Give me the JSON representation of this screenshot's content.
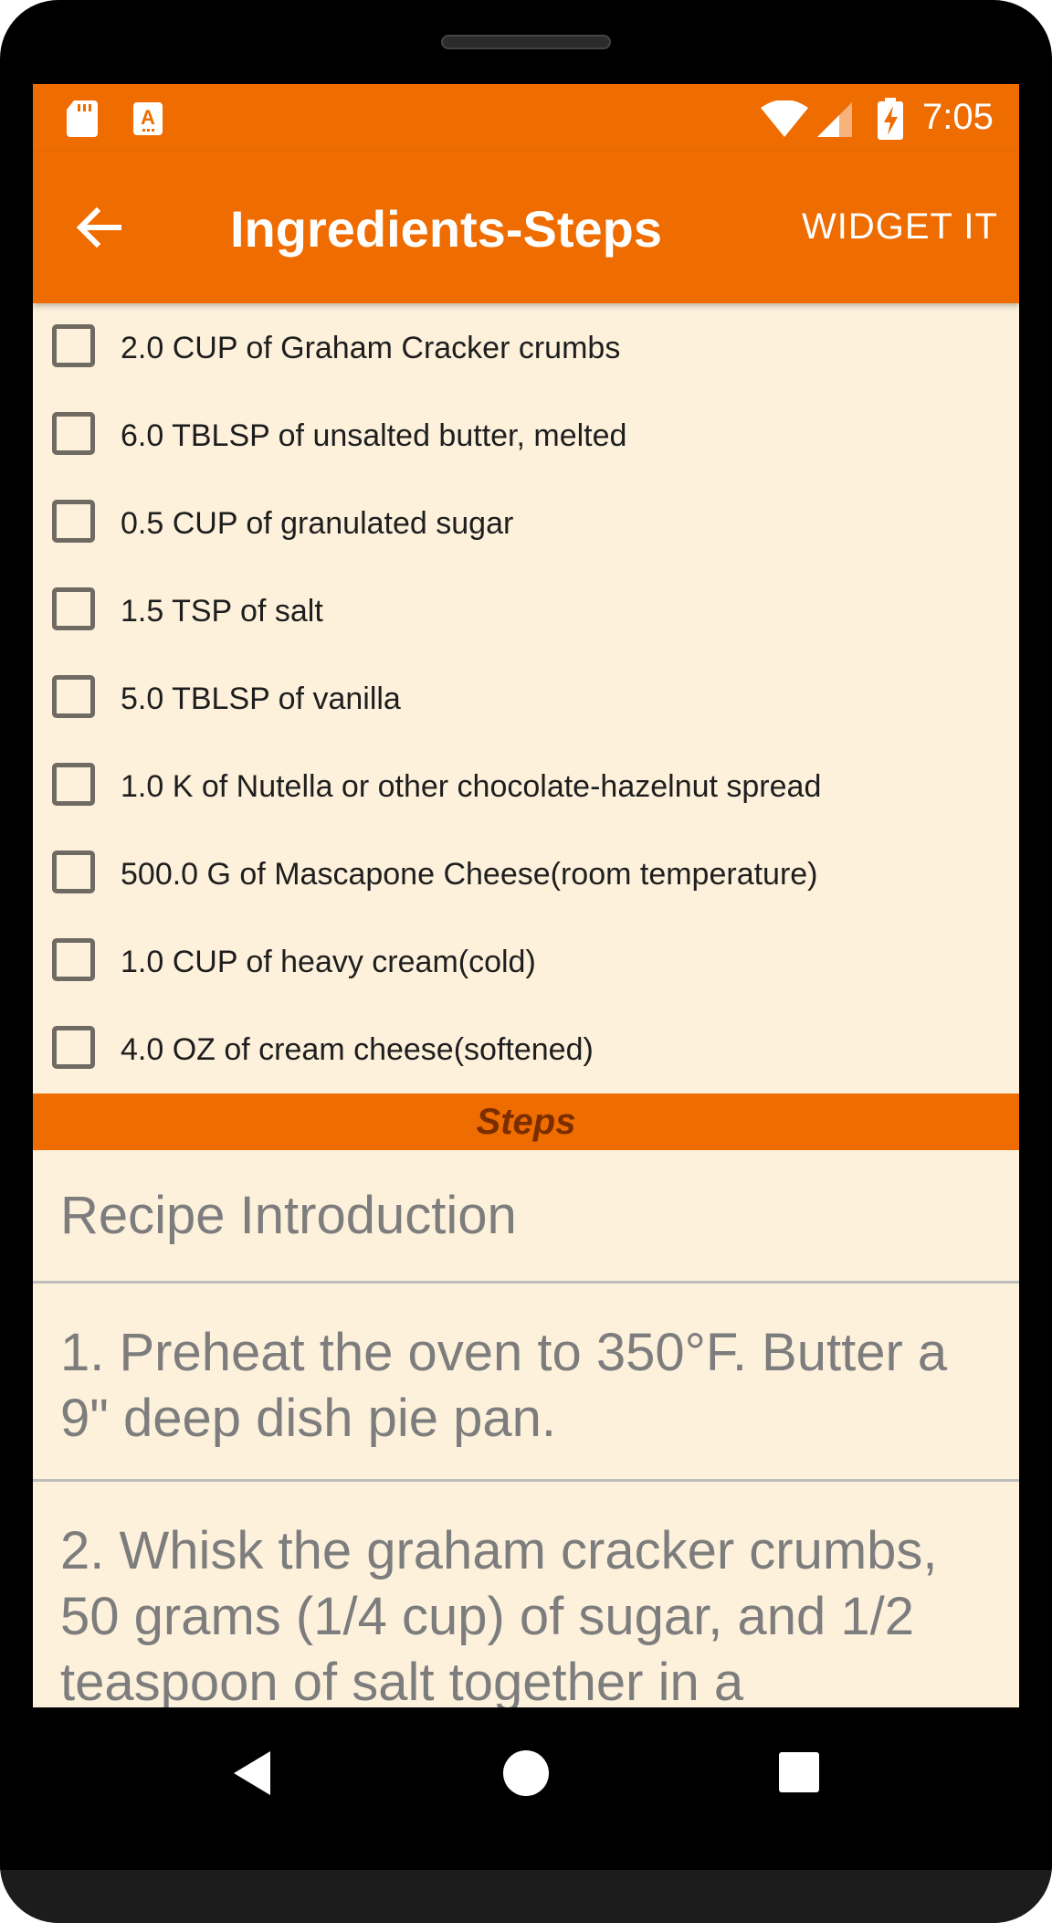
{
  "status_bar": {
    "time": "7:05",
    "icons": [
      "sd-card-icon",
      "accessibility-a-icon",
      "wifi-icon",
      "cell-signal-icon",
      "battery-charging-icon"
    ]
  },
  "app_bar": {
    "title": "Ingredients-Steps",
    "back_icon": "arrow-left-icon",
    "action_label": "WIDGET IT",
    "color": "#ef6c00"
  },
  "ingredients": [
    {
      "label": "2.0 CUP of Graham Cracker crumbs",
      "checked": false
    },
    {
      "label": "6.0 TBLSP of unsalted butter, melted",
      "checked": false
    },
    {
      "label": "0.5 CUP of granulated sugar",
      "checked": false
    },
    {
      "label": "1.5 TSP of salt",
      "checked": false
    },
    {
      "label": "5.0 TBLSP of vanilla",
      "checked": false
    },
    {
      "label": "1.0 K of Nutella or other chocolate-hazelnut spread",
      "checked": false
    },
    {
      "label": "500.0 G of Mascapone Cheese(room temperature)",
      "checked": false
    },
    {
      "label": "1.0 CUP of heavy cream(cold)",
      "checked": false
    },
    {
      "label": "4.0 OZ of cream cheese(softened)",
      "checked": false
    }
  ],
  "steps_header": "Steps",
  "steps": [
    {
      "text": "Recipe Introduction"
    },
    {
      "text": "1. Preheat the oven to 350°F. Butter a 9\" deep dish pie pan."
    },
    {
      "text": "2. Whisk the graham cracker crumbs, 50 grams (1/4 cup) of sugar, and 1/2 teaspoon of salt together in a"
    }
  ],
  "nav_bar": {
    "icons": [
      "nav-back-icon",
      "nav-home-icon",
      "nav-recents-icon"
    ]
  },
  "colors": {
    "accent": "#ef6c00",
    "background": "#fdf1dc",
    "steps_header_text": "#7a2e00"
  }
}
